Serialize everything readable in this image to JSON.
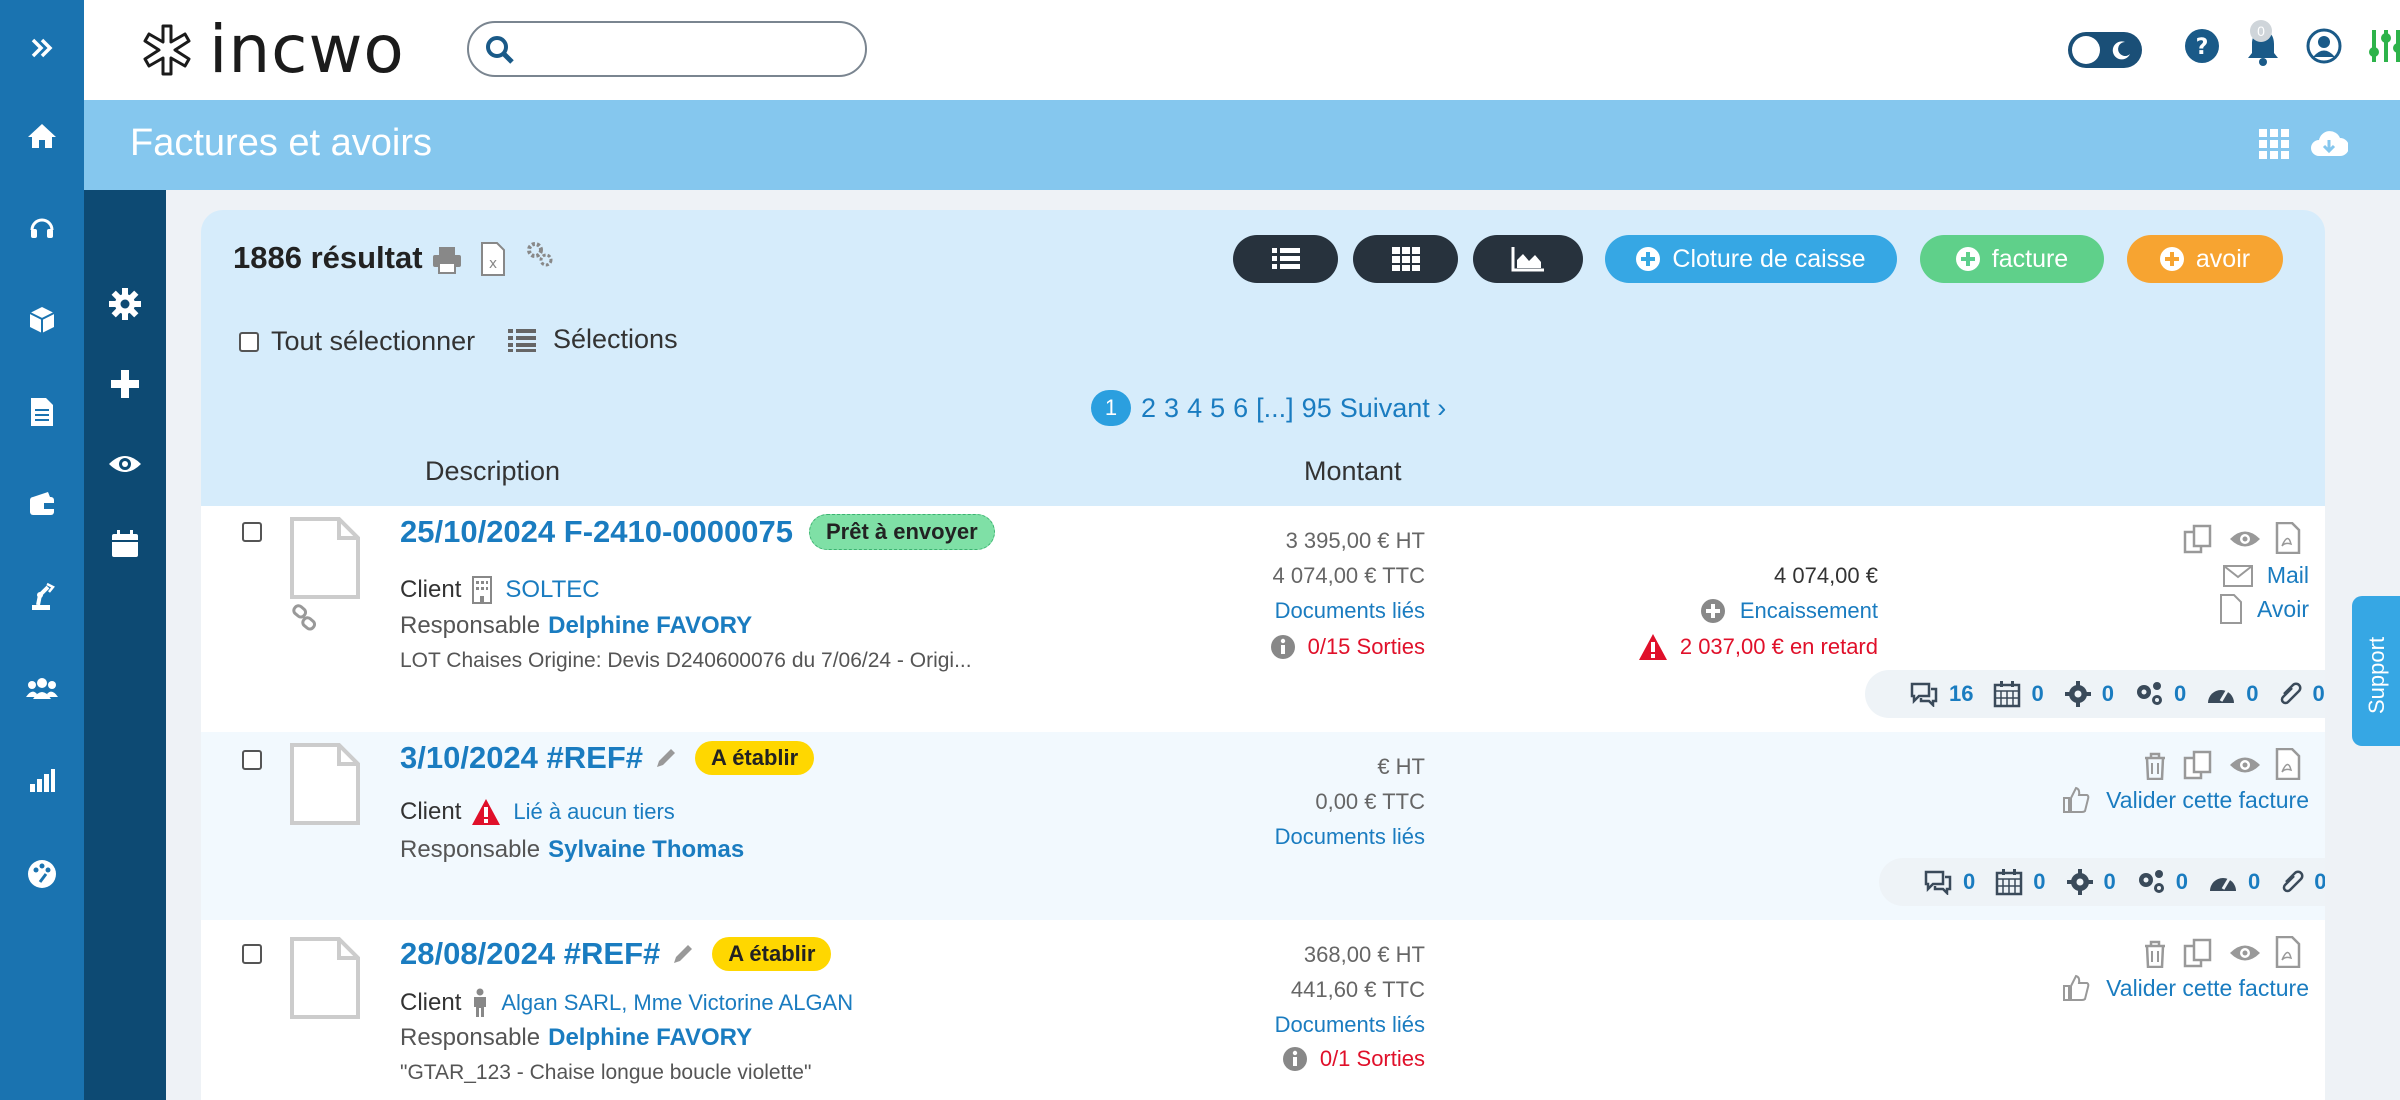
{
  "app": {
    "logo_text": "incwo",
    "search_placeholder": "",
    "notifications_count": "0"
  },
  "page": {
    "title": "Factures et avoirs"
  },
  "toolbar": {
    "results": "1886 résultat",
    "cloture_label": "Cloture de caisse",
    "facture_label": "facture",
    "avoir_label": "avoir",
    "select_all_label": "Tout sélectionner",
    "selections_label": "Sélections"
  },
  "pager": {
    "current": "1",
    "pages": [
      "2",
      "3",
      "4",
      "5",
      "6"
    ],
    "ellipsis": "[...]",
    "last": "95",
    "next": "Suivant ›"
  },
  "columns": {
    "description": "Description",
    "amount": "Montant"
  },
  "labels": {
    "client": "Client",
    "responsable": "Responsable",
    "documents_lies": "Documents liés",
    "encaissement": "Encaissement",
    "mail": "Mail",
    "avoir": "Avoir",
    "valider": "Valider cette facture"
  },
  "rows": [
    {
      "date_ref": "25/10/2024  F-2410-0000075",
      "status": "Prêt à envoyer",
      "client": "SOLTEC",
      "responsable": "Delphine FAVORY",
      "note": "LOT Chaises Origine: Devis D240600076 du 7/06/24 - Origi...",
      "ht": "3 395,00 € HT",
      "ttc": "4 074,00 € TTC",
      "sorties": "0/15 Sorties",
      "total": "4 074,00 €",
      "retard": "2 037,00 € en retard",
      "stats": [
        "16",
        "0",
        "0",
        "0",
        "0",
        "0"
      ]
    },
    {
      "date_ref": "3/10/2024  #REF#",
      "status": "A établir",
      "client": "Lié à aucun tiers",
      "responsable": "Sylvaine Thomas",
      "ht": "€ HT",
      "ttc": "0,00 € TTC",
      "stats": [
        "0",
        "0",
        "0",
        "0",
        "0",
        "0"
      ]
    },
    {
      "date_ref": "28/08/2024  #REF#",
      "status": "A établir",
      "client": "Algan SARL, Mme Victorine ALGAN",
      "responsable": "Delphine FAVORY",
      "note": "\"GTAR_123 - Chaise longue boucle violette\"",
      "ht": "368,00 € HT",
      "ttc": "441,60 € TTC",
      "sorties": "0/1 Sorties"
    }
  ],
  "support": {
    "label": "Support"
  },
  "colors": {
    "rail": "#1a73b0",
    "rail_dark": "#0d4a73",
    "header": "#85c7ee",
    "panel": "#d6ecfb",
    "link": "#1a7cc0",
    "danger": "#e0102a",
    "green_accent": "#2db34a"
  }
}
